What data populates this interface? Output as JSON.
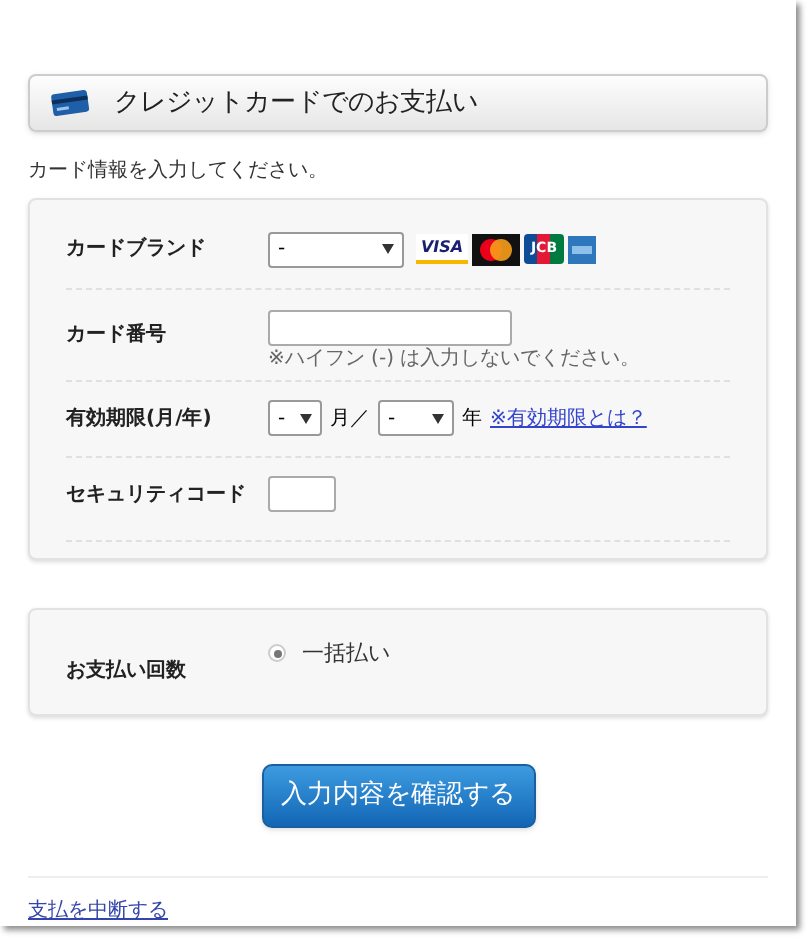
{
  "header": {
    "title": "クレジットカードでのお支払い"
  },
  "intro": "カード情報を入力してください。",
  "card_form": {
    "rows": [
      {
        "kind": "brand",
        "label": "カードブランド",
        "value": "-",
        "brands": [
          {
            "kind": "visa",
            "label": "VISA"
          },
          {
            "kind": "mastercard"
          },
          {
            "kind": "jcb",
            "label": "JCB"
          },
          {
            "kind": "amex"
          }
        ]
      },
      {
        "kind": "number",
        "label": "カード番号",
        "hint": "※ハイフン (-) は入力しないでください。"
      },
      {
        "kind": "expiry",
        "label": "有効期限(月/年)",
        "month": "-",
        "month_unit": "月／",
        "year": "-",
        "year_unit": "年",
        "link": "※有効期限とは？"
      },
      {
        "kind": "security",
        "label": "セキュリティコード"
      }
    ]
  },
  "installments": {
    "label": "お支払い回数",
    "options": [
      {
        "label": "一括払い",
        "selected": true
      }
    ]
  },
  "confirm_button": "入力内容を確認する",
  "cancel_link": "支払を中断する"
}
